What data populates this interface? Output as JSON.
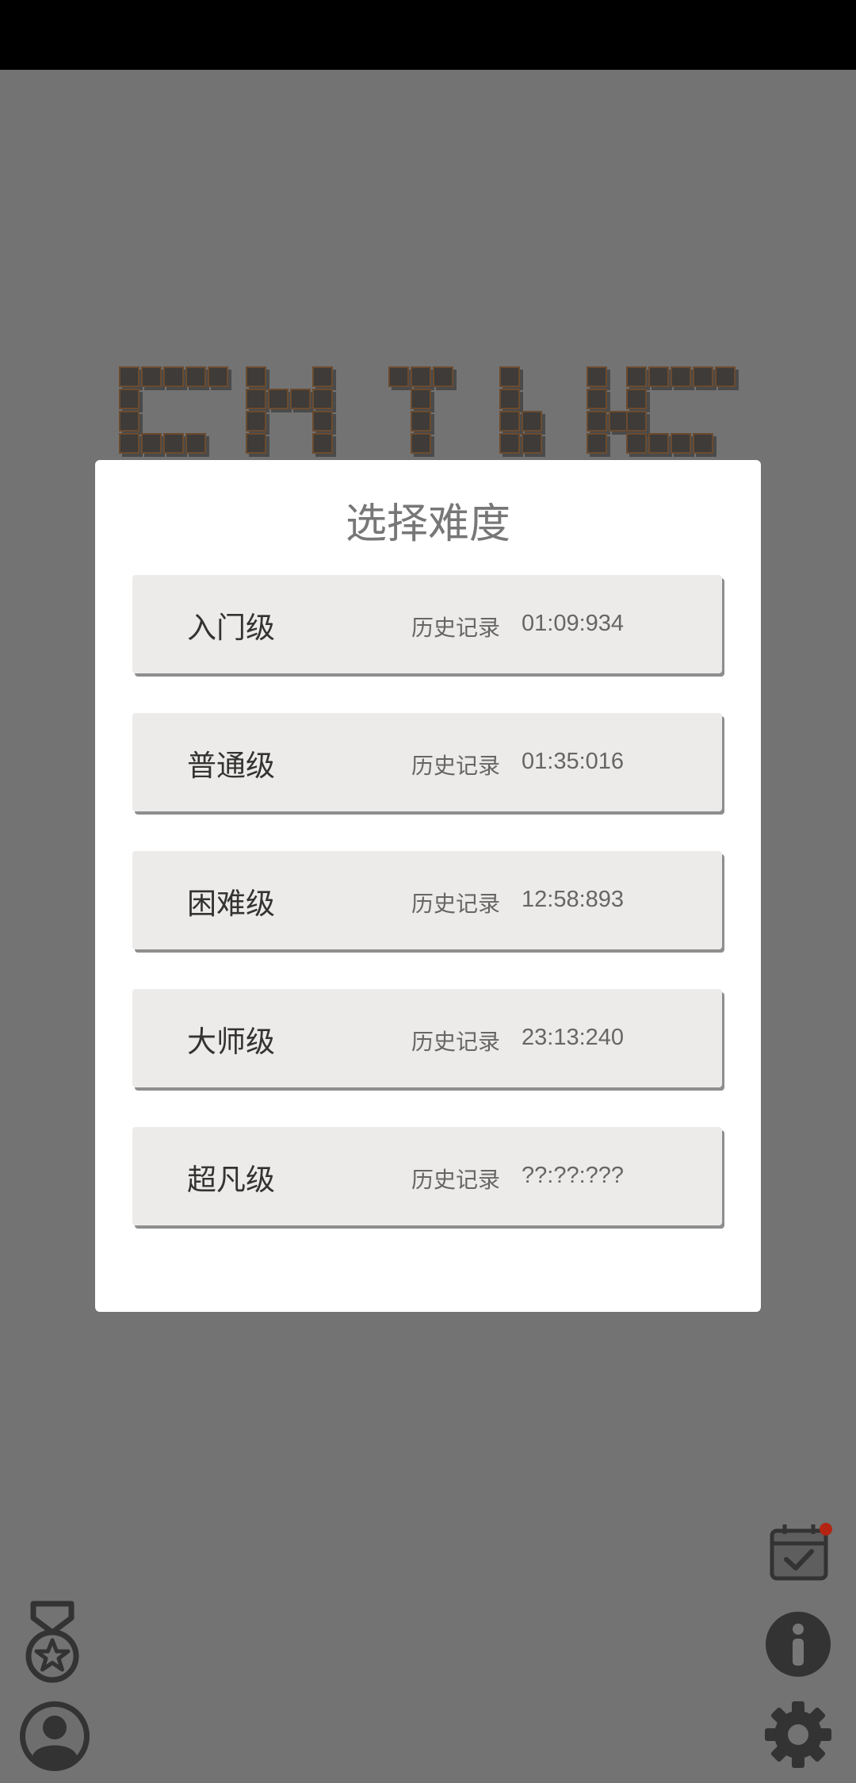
{
  "dialog": {
    "title": "选择难度",
    "levels": [
      {
        "name": "入门级",
        "record_label": "历史记录",
        "record_time": "01:09:934"
      },
      {
        "name": "普通级",
        "record_label": "历史记录",
        "record_time": "01:35:016"
      },
      {
        "name": "困难级",
        "record_label": "历史记录",
        "record_time": "12:58:893"
      },
      {
        "name": "大师级",
        "record_label": "历史记录",
        "record_time": "23:13:240"
      },
      {
        "name": "超凡级",
        "record_label": "历史记录",
        "record_time": "??:??:???"
      }
    ]
  },
  "icons": {
    "achievements": "medal-star-icon",
    "profile": "user-avatar-icon",
    "daily_challenge": "calendar-check-icon",
    "info": "info-icon",
    "settings": "gear-icon"
  },
  "colors": {
    "background": "#737373",
    "dialog": "#ffffff",
    "card": "#edebe9",
    "notification": "#b32412",
    "logo_block": "#3e3b38",
    "logo_border": "#6b4b2f"
  }
}
